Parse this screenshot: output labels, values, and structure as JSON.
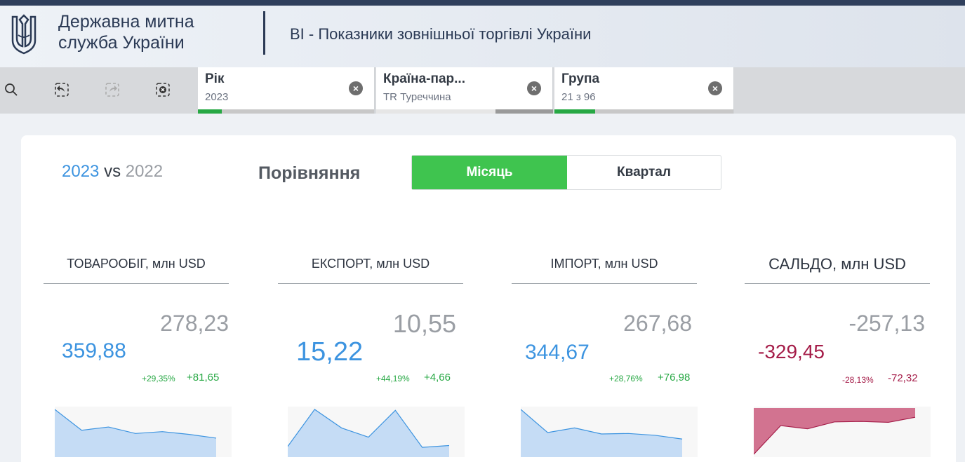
{
  "header": {
    "org_name_line1": "Державна митна",
    "org_name_line2": "служба України",
    "app_title": "BI - Показники зовнішньої торгівлі України"
  },
  "toolbar": {
    "icons": [
      "smart-search-icon",
      "step-back-icon",
      "step-forward-icon",
      "clear-selections-icon"
    ]
  },
  "selections": [
    {
      "title": "Рік",
      "value": "2023",
      "green_fraction": 0.12
    },
    {
      "title": "Країна-пар...",
      "value": "TR Туреччина",
      "green_fraction": 0.0
    },
    {
      "title": "Група",
      "value": "21 з 96",
      "green_fraction": 0.22
    }
  ],
  "comparison": {
    "year_current": "2023",
    "vs": "vs",
    "year_previous": "2022",
    "label": "Порівняння",
    "options": [
      "Місяць",
      "Квартал"
    ],
    "selected": "Місяць"
  },
  "kpis": [
    {
      "title": "ТОВАРООБІГ, млн USD",
      "previous": "278,23",
      "current": "359,88",
      "pct": "+29,35%",
      "diff": "+81,65",
      "trend": "positive"
    },
    {
      "title": "ЕКСПОРТ, млн USD",
      "previous": "10,55",
      "current": "15,22",
      "pct": "+44,19%",
      "diff": "+4,66",
      "trend": "positive"
    },
    {
      "title": "ІМПОРТ, млн USD",
      "previous": "267,68",
      "current": "344,67",
      "pct": "+28,76%",
      "diff": "+76,98",
      "trend": "positive"
    },
    {
      "title": "САЛЬДО, млн USD",
      "previous": "-257,13",
      "current": "-329,45",
      "pct": "-28,13%",
      "diff": "-72,32",
      "trend": "negative"
    }
  ],
  "chart_data": [
    {
      "type": "area",
      "values": [
        100,
        55,
        62,
        48,
        52,
        46,
        38
      ],
      "color": "#c5dcf5",
      "stroke": "#3d94e0"
    },
    {
      "type": "area",
      "values": [
        20,
        100,
        60,
        40,
        98,
        18,
        22
      ],
      "color": "#c5dcf5",
      "stroke": "#3d94e0"
    },
    {
      "type": "area",
      "values": [
        100,
        50,
        60,
        47,
        48,
        44,
        36
      ],
      "color": "#c5dcf5",
      "stroke": "#3d94e0"
    },
    {
      "type": "area",
      "values": [
        -100,
        -38,
        -45,
        -30,
        -29,
        -31,
        -20
      ],
      "color": "#d27390",
      "stroke": "#a51d49"
    }
  ]
}
